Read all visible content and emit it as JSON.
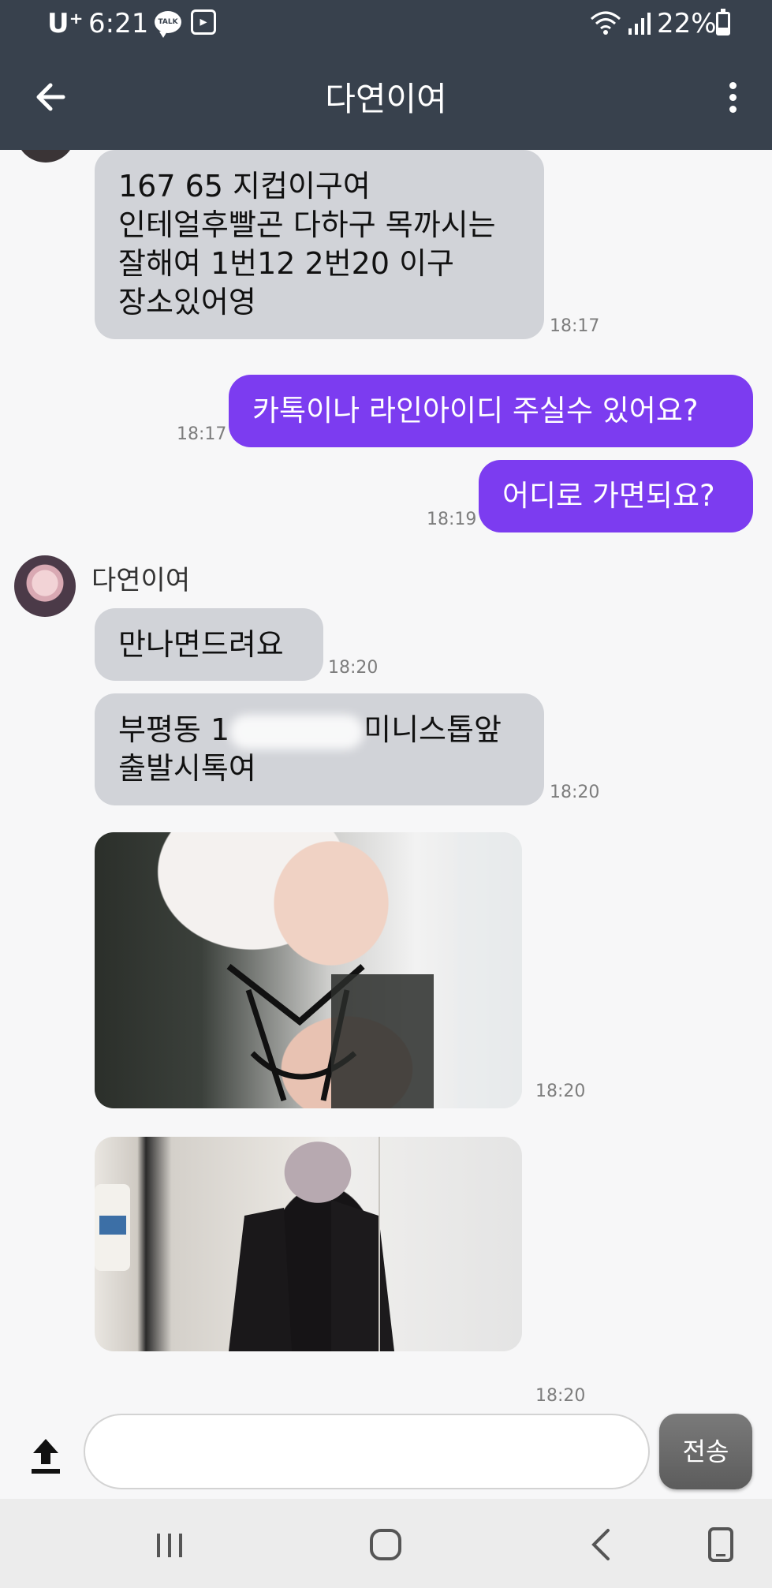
{
  "status_bar": {
    "carrier": "U⁺",
    "time": "6:21",
    "talk_badge": "TALK",
    "battery": "22%"
  },
  "header": {
    "title": "다연이여"
  },
  "messages": [
    {
      "type": "in",
      "lines": [
        "167  65  지컵이구여",
        "인테얼후빨곤 다하구 목까시는",
        "잘해여  1번12  2번20 이구",
        "장소있어영"
      ],
      "time": "18:17"
    },
    {
      "type": "out",
      "text": "카톡이나 라인아이디 주실수 있어요?",
      "time": "18:17"
    },
    {
      "type": "out",
      "text": "어디로 가면되요?",
      "time": "18:19"
    },
    {
      "type": "in",
      "text": "만나면드려요",
      "time": "18:20"
    },
    {
      "type": "in",
      "line1_a": "부평동 1",
      "line1_b": "미니스톱앞",
      "line2": "출발시톡여",
      "time": "18:20"
    },
    {
      "type": "image",
      "time": "18:20"
    },
    {
      "type": "image",
      "time": "18:20"
    }
  ],
  "sender": {
    "name": "다연이여"
  },
  "composer": {
    "value": "",
    "placeholder": "",
    "send_label": "전송"
  },
  "colors": {
    "header_bg": "#38414d",
    "outgoing_bubble": "#7c3cf0",
    "incoming_bubble": "#d1d3d8",
    "send_button": "#666666"
  },
  "icons": [
    "arrow-left-icon",
    "more-vertical-icon",
    "upload-icon",
    "nav-recents-icon",
    "nav-home-icon",
    "nav-back-icon",
    "nav-rotate-icon"
  ]
}
